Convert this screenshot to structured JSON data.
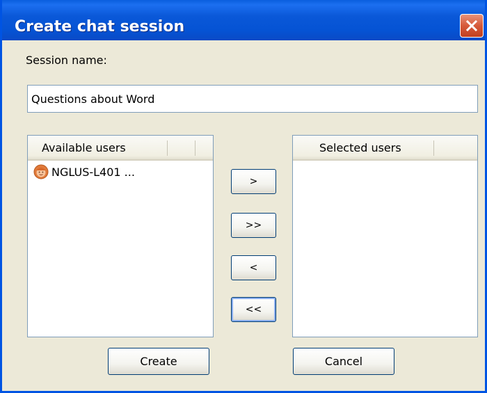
{
  "window": {
    "title": "Create chat session"
  },
  "session": {
    "name_label": "Session name:",
    "name_value": "Questions about Word"
  },
  "available": {
    "header": "Available users",
    "items": [
      {
        "label": "NGLUS-L401 ...",
        "icon": "user-face-icon"
      }
    ]
  },
  "selected": {
    "header": "Selected users",
    "items": []
  },
  "transfer_buttons": {
    "add": ">",
    "add_all": ">>",
    "remove": "<",
    "remove_all": "<<"
  },
  "actions": {
    "create": "Create",
    "cancel": "Cancel"
  },
  "colors": {
    "titlebar": "#0a58d8",
    "dialog_bg": "#ece9d8",
    "close_button": "#d65a3a",
    "field_border": "#7f9db9"
  }
}
